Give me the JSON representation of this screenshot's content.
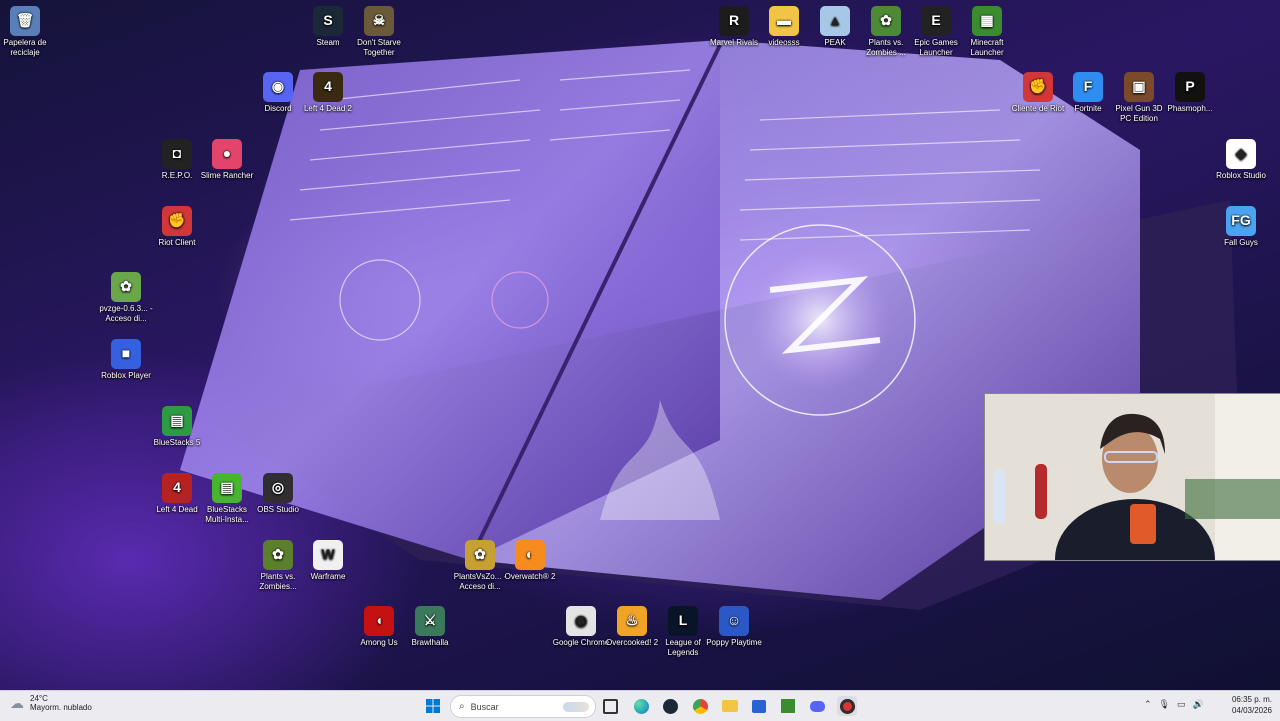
{
  "desktop": {
    "icons": [
      {
        "label": "Papelera de reciclaje",
        "glyph": "🗑",
        "color": "#5a7fb8",
        "icon": "recycle-bin-icon"
      },
      {
        "label": "Steam",
        "glyph": "S",
        "color": "#1b2838",
        "icon": "steam-icon"
      },
      {
        "label": "Don't Starve Together",
        "glyph": "☠",
        "color": "#6b5a3a",
        "icon": "dont-starve-icon"
      },
      {
        "label": "Discord",
        "glyph": "◉",
        "color": "#5865f2",
        "icon": "discord-icon"
      },
      {
        "label": "Left 4 Dead 2",
        "glyph": "4",
        "color": "#3b2a12",
        "icon": "left4dead2-icon"
      },
      {
        "label": "R.E.P.O.",
        "glyph": "◘",
        "color": "#222",
        "icon": "repo-icon"
      },
      {
        "label": "Slime Rancher",
        "glyph": "●",
        "color": "#e2446b",
        "icon": "slime-rancher-icon"
      },
      {
        "label": "Riot Client",
        "glyph": "✊",
        "color": "#d13639",
        "icon": "riot-client-icon"
      },
      {
        "label": "pvzge-0.6.3... - Acceso di...",
        "glyph": "✿",
        "color": "#6aa64a",
        "icon": "pvz-ge-icon"
      },
      {
        "label": "Roblox Player",
        "glyph": "■",
        "color": "#3560e0",
        "icon": "roblox-player-icon"
      },
      {
        "label": "BlueStacks 5",
        "glyph": "▤",
        "color": "#2e9a44",
        "icon": "bluestacks-icon"
      },
      {
        "label": "Left 4 Dead",
        "glyph": "4",
        "color": "#b52222",
        "icon": "left4dead-icon"
      },
      {
        "label": "BlueStacks Multi-Insta...",
        "glyph": "▤",
        "color": "#47b52f",
        "icon": "bluestacks-multi-icon"
      },
      {
        "label": "OBS Studio",
        "glyph": "◎",
        "color": "#302e31",
        "icon": "obs-icon"
      },
      {
        "label": "Plants vs. Zombies...",
        "glyph": "✿",
        "color": "#5b7f2b",
        "icon": "pvz-icon"
      },
      {
        "label": "Warframe",
        "glyph": "W",
        "color": "#f0f0f0",
        "icon": "warframe-icon"
      },
      {
        "label": "PlantsVsZo... - Acceso di...",
        "glyph": "✿",
        "color": "#c7a033",
        "icon": "pvz-shortcut-icon"
      },
      {
        "label": "Overwatch® 2",
        "glyph": "◐",
        "color": "#f68c1e",
        "icon": "overwatch-icon"
      },
      {
        "label": "Among Us",
        "glyph": "◖",
        "color": "#c51111",
        "icon": "among-us-icon"
      },
      {
        "label": "Brawlhalla",
        "glyph": "⚔",
        "color": "#3a7a5a",
        "icon": "brawlhalla-icon"
      },
      {
        "label": "Google Chrome",
        "glyph": "◉",
        "color": "#e4e4e4",
        "icon": "chrome-icon"
      },
      {
        "label": "Overcooked! 2",
        "glyph": "♨",
        "color": "#f0a326",
        "icon": "overcooked-icon"
      },
      {
        "label": "League of Legends",
        "glyph": "L",
        "color": "#0a1428",
        "icon": "league-icon"
      },
      {
        "label": "Poppy Playtime",
        "glyph": "☺",
        "color": "#2b58c7",
        "icon": "poppy-playtime-icon"
      },
      {
        "label": "Marvel Rivals",
        "glyph": "R",
        "color": "#1c1c1c",
        "icon": "marvel-rivals-icon"
      },
      {
        "label": "videosss",
        "glyph": "▬",
        "color": "#f2c445",
        "icon": "folder-icon"
      },
      {
        "label": "PEAK",
        "glyph": "▲",
        "color": "#a7c7e7",
        "icon": "peak-icon"
      },
      {
        "label": "Plants vs. Zombies ...",
        "glyph": "✿",
        "color": "#4d8a36",
        "icon": "pvz2-icon"
      },
      {
        "label": "Epic Games Launcher",
        "glyph": "E",
        "color": "#222",
        "icon": "epic-games-icon"
      },
      {
        "label": "Minecraft Launcher",
        "glyph": "▦",
        "color": "#3b8c2e",
        "icon": "minecraft-icon"
      },
      {
        "label": "Cliente de Riot",
        "glyph": "✊",
        "color": "#d13639",
        "icon": "riot-cliente-icon"
      },
      {
        "label": "Fortnite",
        "glyph": "F",
        "color": "#2f8cf0",
        "icon": "fortnite-icon"
      },
      {
        "label": "Pixel Gun 3D PC Edition",
        "glyph": "▣",
        "color": "#7a4a2a",
        "icon": "pixel-gun-icon"
      },
      {
        "label": "Phasmoph...",
        "glyph": "P",
        "color": "#111",
        "icon": "phasmophobia-icon"
      },
      {
        "label": "Roblox Studio",
        "glyph": "◆",
        "color": "#fff",
        "icon": "roblox-studio-icon"
      },
      {
        "label": "Fall Guys",
        "glyph": "FG",
        "color": "#4aa3f0",
        "icon": "fall-guys-icon"
      }
    ]
  },
  "taskbar": {
    "weather_temp": "24°C",
    "weather_desc": "Mayorm. nublado",
    "search_placeholder": "Buscar",
    "time": "06:35 p. m.",
    "date": "04/03/2026"
  }
}
